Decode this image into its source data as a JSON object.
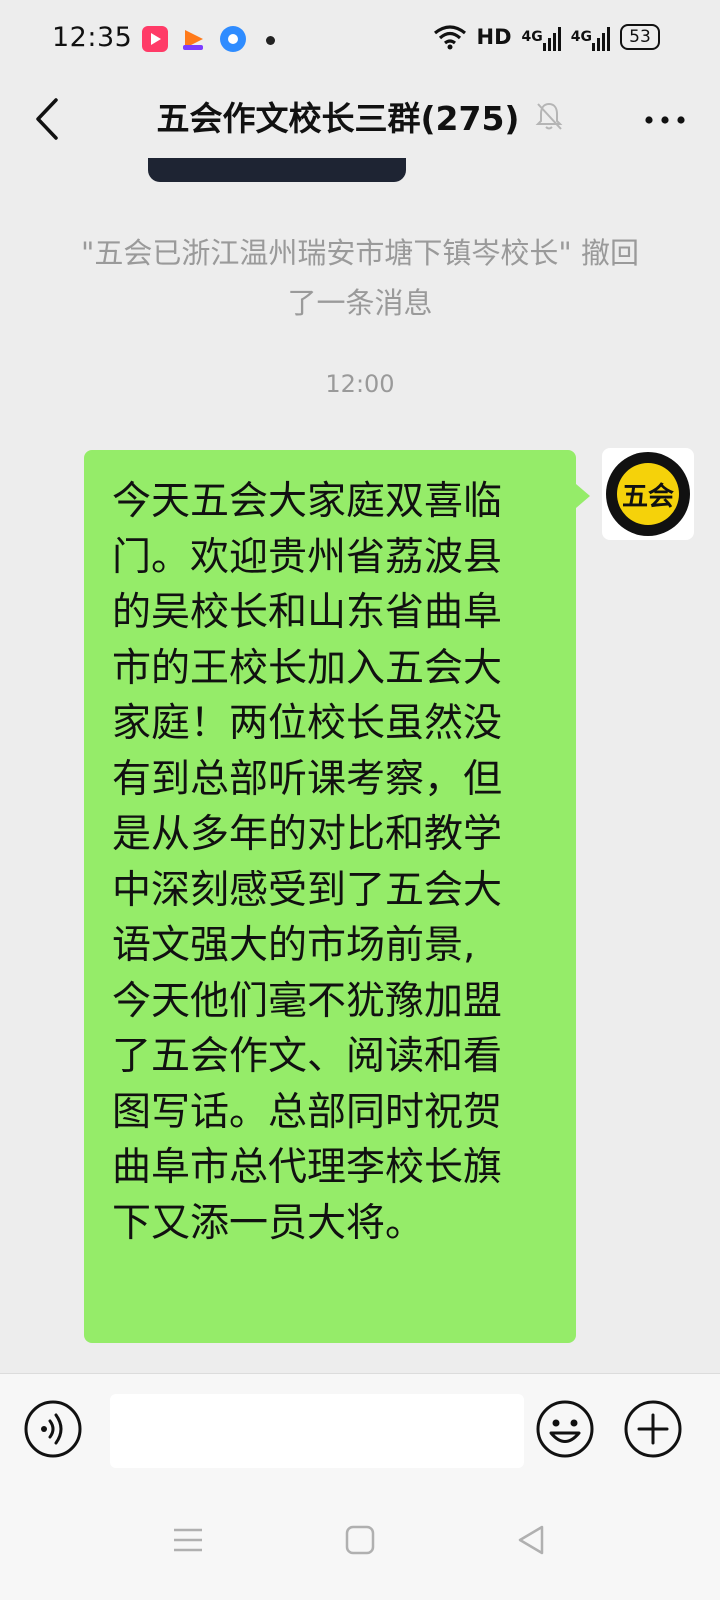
{
  "status_bar": {
    "time": "12:35",
    "hd_label": "HD",
    "sim1": "4G",
    "sim2": "4G",
    "battery": "53",
    "icons": [
      "video-app-icon",
      "orange-app-icon",
      "blue-app-icon",
      "wifi-icon",
      "signal-icon",
      "battery-icon"
    ]
  },
  "header": {
    "title": "五会作文校长三群(275)",
    "icons": [
      "back-icon",
      "mute-bell-icon",
      "more-icon"
    ]
  },
  "chat": {
    "recall_notice": "\"五会已浙江温州瑞安市塘下镇岑校长\" 撤回了一条消息",
    "timestamp": "12:00",
    "message": {
      "lines": [
        "今天五会大家庭双喜临",
        "门。欢迎贵州省荔波县",
        "的吴校长和山东省曲阜",
        "市的王校长加入五会大",
        "家庭！两位校长虽然没",
        "有到总部听课考察，但",
        "是从多年的对比和教学",
        "中深刻感受到了五会大",
        "语文强大的市场前景,",
        "今天他们毫不犹豫加盟",
        "了五会作文、阅读和看",
        "图写话。总部同时祝贺",
        "曲阜市总代理李校长旗",
        "下又添一员大将。"
      ],
      "bubble_color": "#95ec69"
    },
    "avatar": {
      "logo_text": "五会",
      "icon": "wuhui-logo-icon",
      "colors": {
        "ring": "#111111",
        "fill": "#f5d20a"
      }
    }
  },
  "input_bar": {
    "icons": [
      "voice-icon",
      "emoji-icon",
      "plus-icon"
    ],
    "value": ""
  },
  "nav_bar": {
    "icons": [
      "menu-icon",
      "home-icon",
      "back-triangle-icon"
    ]
  }
}
